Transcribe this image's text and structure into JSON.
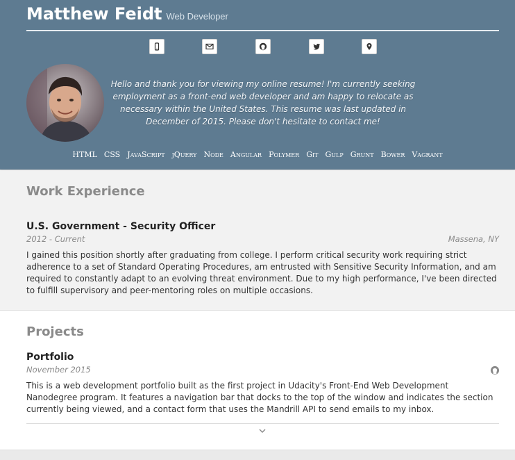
{
  "header": {
    "name": "Matthew Feidt",
    "role": "Web Developer",
    "intro": "Hello and thank you for viewing my online resume! I'm currently seeking employment as a front-end web developer and am happy to relocate as necessary within the United States. This resume was last updated in December of 2015. Please don't hesitate to contact me!",
    "contacts": [
      {
        "icon": "mobile-icon"
      },
      {
        "icon": "envelope-icon"
      },
      {
        "icon": "github-icon"
      },
      {
        "icon": "twitter-icon"
      },
      {
        "icon": "map-marker-icon"
      }
    ],
    "skills": [
      "HTML",
      "CSS",
      "JavaScript",
      "jQuery",
      "Node",
      "Angular",
      "Polymer",
      "Git",
      "Gulp",
      "Grunt",
      "Bower",
      "Vagrant"
    ]
  },
  "work": {
    "title": "Work Experience",
    "jobs": [
      {
        "title": "U.S. Government - Security Officer",
        "dates": "2012 - Current",
        "location": "Massena, NY",
        "description": "I gained this position shortly after graduating from college. I perform critical security work requiring strict adherence to a set of Standard Operating Procedures, am entrusted with Sensitive Security Information, and am required to constantly adapt to an evolving threat environment. Due to my high performance, I've been directed to fulfill supervisory and peer-mentoring roles on multiple occasions."
      }
    ]
  },
  "projects": {
    "title": "Projects",
    "items": [
      {
        "title": "Portfolio",
        "date": "November 2015",
        "description": "This is a web development portfolio built as the first project in Udacity's Front-End Web Development Nanodegree program. It features a navigation bar that docks to the top of the window and indicates the section currently being viewed, and a contact form that uses the Mandrill API to send emails to my inbox."
      }
    ]
  },
  "colors": {
    "header_bg": "#5e7b91",
    "section_bg": "#f2f2f2",
    "section_title": "#8a8a8a"
  }
}
